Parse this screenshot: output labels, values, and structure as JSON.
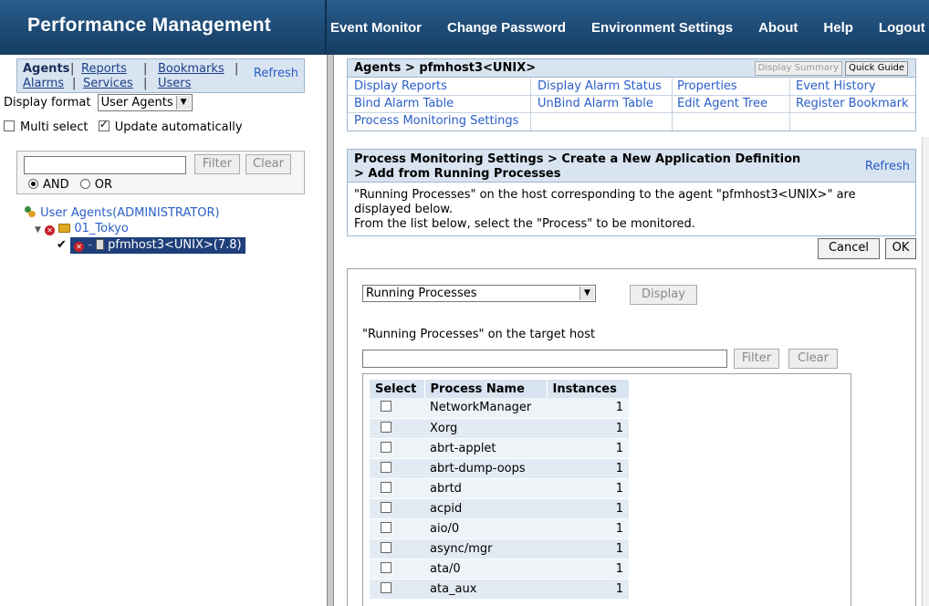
{
  "header": {
    "app_title": "Performance Management",
    "nav": [
      "Event Monitor",
      "Change Password",
      "Environment Settings",
      "About",
      "Help",
      "Logout"
    ]
  },
  "left": {
    "tabs_row1": [
      "Agents",
      "Reports",
      "Bookmarks"
    ],
    "tabs_row2": [
      "Alarms",
      "Services",
      "Users"
    ],
    "refresh": "Refresh",
    "display_format_label": "Display format",
    "display_format_value": "User Agents",
    "multi_select": "Multi select",
    "update_automatically": "Update automatically",
    "filter_button": "Filter",
    "clear_button": "Clear",
    "and_label": "AND",
    "or_label": "OR",
    "tree": {
      "root": "User Agents(ADMINISTRATOR)",
      "folder": "01_Tokyo",
      "host": "pfmhost3<UNIX>(7.8)"
    }
  },
  "agent_panel": {
    "title": "Agents > pfmhost3<UNIX>",
    "display_summary": "Display Summary",
    "quick_guide": "Quick Guide",
    "menu": [
      [
        "Display Reports",
        "Display Alarm Status",
        "Properties",
        "Event History"
      ],
      [
        "Bind Alarm Table",
        "UnBind Alarm Table",
        "Edit Agent Tree",
        "Register Bookmark"
      ],
      [
        "Process Monitoring Settings",
        "",
        "",
        ""
      ]
    ]
  },
  "detail_panel": {
    "title_line1": "Process Monitoring Settings > Create a New Application Definition",
    "title_line2": "> Add from Running Processes",
    "refresh": "Refresh",
    "desc_line1": "\"Running Processes\" on the host corresponding to the agent \"pfmhost3<UNIX>\" are",
    "desc_line2": "displayed below.",
    "desc_line3": "From the list below, select the \"Process\" to be monitored.",
    "cancel": "Cancel",
    "ok": "OK"
  },
  "content": {
    "source_select": "Running Processes",
    "display_button": "Display",
    "section_label": "\"Running Processes\" on the target host",
    "filter_button": "Filter",
    "clear_button": "Clear",
    "columns": [
      "Select",
      "Process Name",
      "Instances"
    ],
    "rows": [
      {
        "name": "NetworkManager",
        "instances": "1"
      },
      {
        "name": "Xorg",
        "instances": "1"
      },
      {
        "name": "abrt-applet",
        "instances": "1"
      },
      {
        "name": "abrt-dump-oops",
        "instances": "1"
      },
      {
        "name": "abrtd",
        "instances": "1"
      },
      {
        "name": "acpid",
        "instances": "1"
      },
      {
        "name": "aio/0",
        "instances": "1"
      },
      {
        "name": "async/mgr",
        "instances": "1"
      },
      {
        "name": "ata/0",
        "instances": "1"
      },
      {
        "name": "ata_aux",
        "instances": "1"
      }
    ]
  },
  "colors": {
    "header": "#1d4a75",
    "panel_head": "#d8e4f0",
    "link": "#2a5ec8",
    "selected_node": "#1f3f7a"
  }
}
